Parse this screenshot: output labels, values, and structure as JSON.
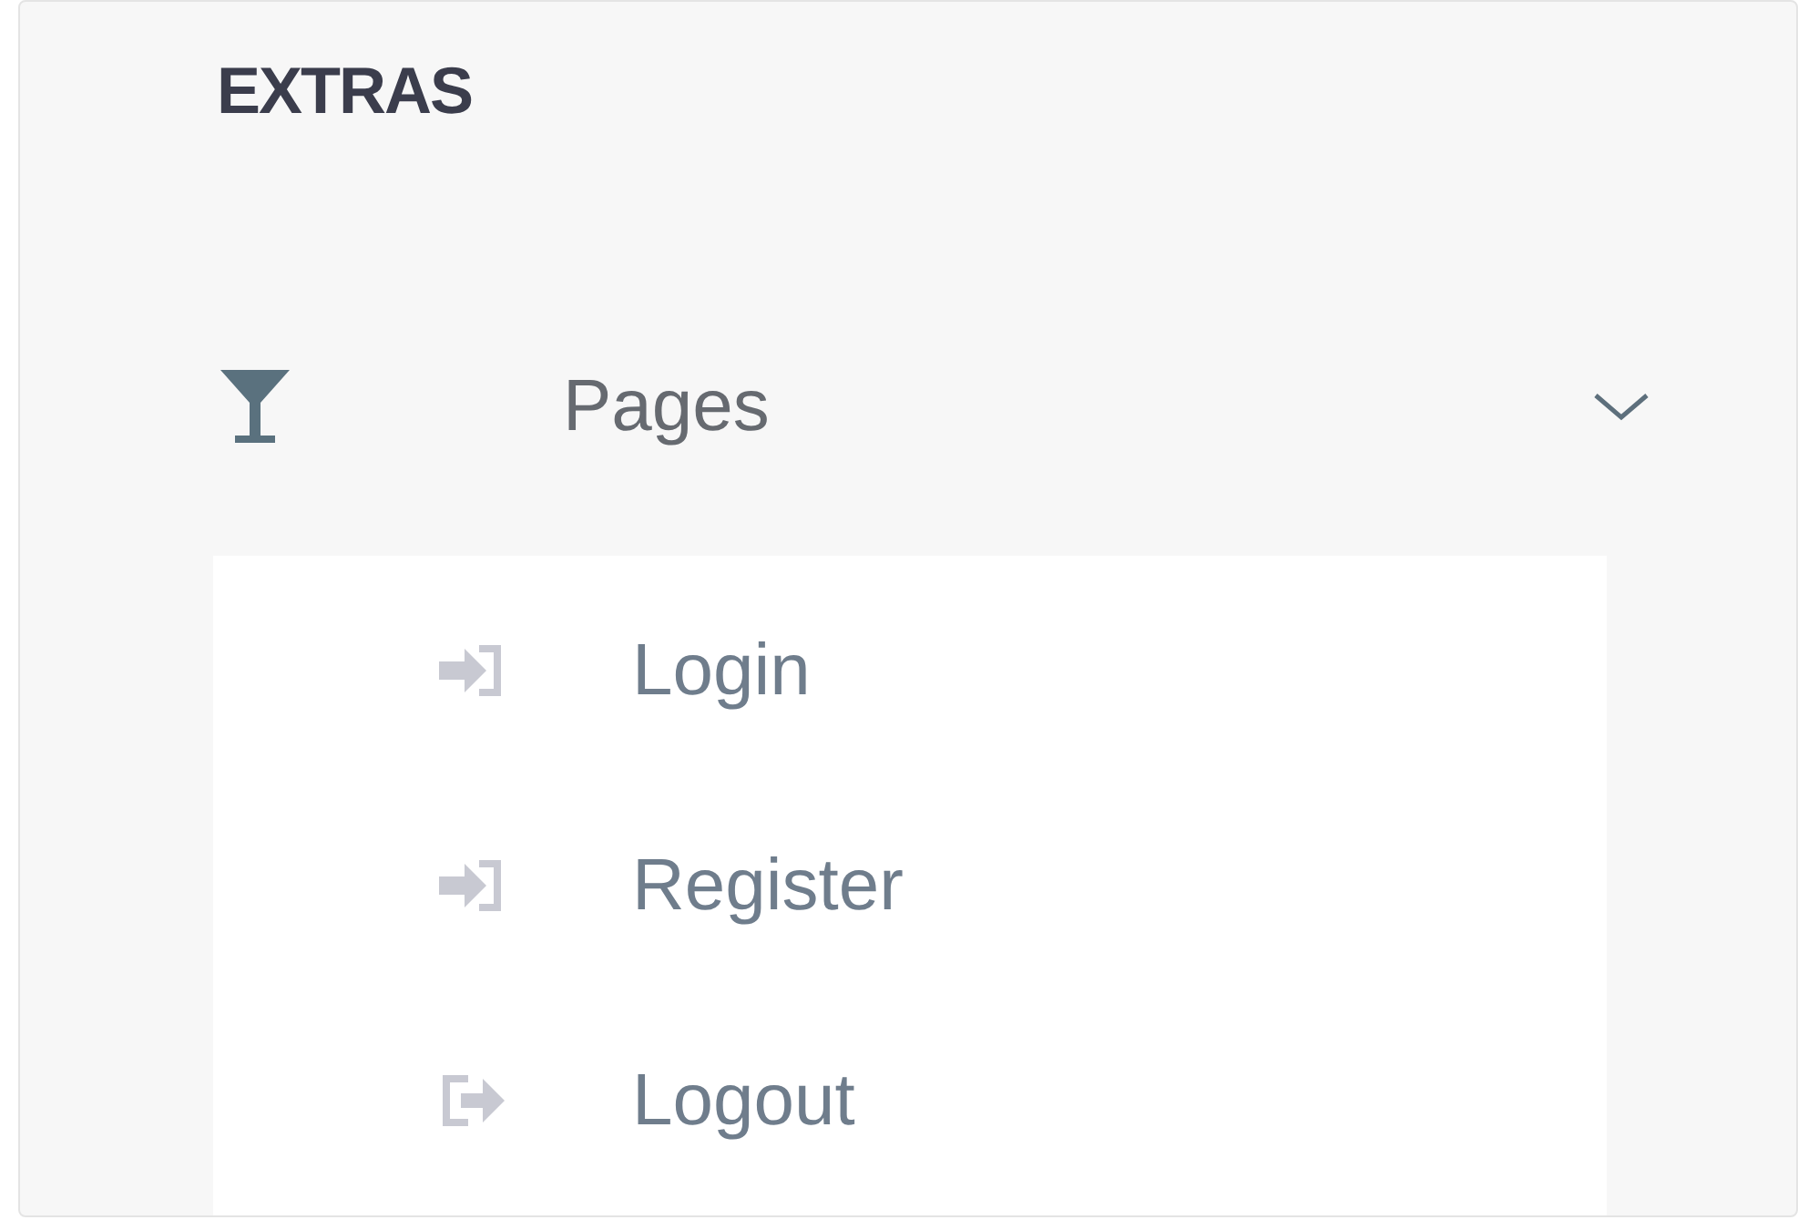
{
  "section_title": "EXTRAS",
  "menu": {
    "label": "Pages",
    "expanded": true,
    "children": [
      {
        "label": "Login",
        "kind": "sign-in"
      },
      {
        "label": "Register",
        "kind": "sign-in"
      },
      {
        "label": "Logout",
        "kind": "sign-out"
      }
    ]
  }
}
